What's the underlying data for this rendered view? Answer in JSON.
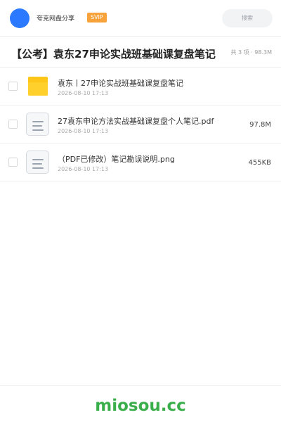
{
  "header": {
    "user_name": "夸克网盘分享",
    "badge": "SVIP",
    "search_placeholder": "搜索",
    "avatar_color": "#2a79ff",
    "badge_color": "#f7a23b"
  },
  "title_bar": {
    "title": "【公考】袁东27申论实战班基础课复盘笔记",
    "summary": "共 3 项 · 98.3M"
  },
  "files": [
    {
      "icon": "folder-icon",
      "name": "袁东丨27申论实战班基础课复盘笔记",
      "date": "2026-08-10 17:13",
      "size": ""
    },
    {
      "icon": "document-icon",
      "name": "27袁东申论方法实战基础课复盘个人笔记.pdf",
      "date": "2026-08-10 17:13",
      "size": "97.8M"
    },
    {
      "icon": "document-icon",
      "name": "（PDF已修改）笔记勘误说明.png",
      "date": "2026-08-10 17:13",
      "size": "455KB"
    }
  ],
  "footer": {
    "site": "miosou.cc",
    "site_color": "#3aae4a"
  }
}
